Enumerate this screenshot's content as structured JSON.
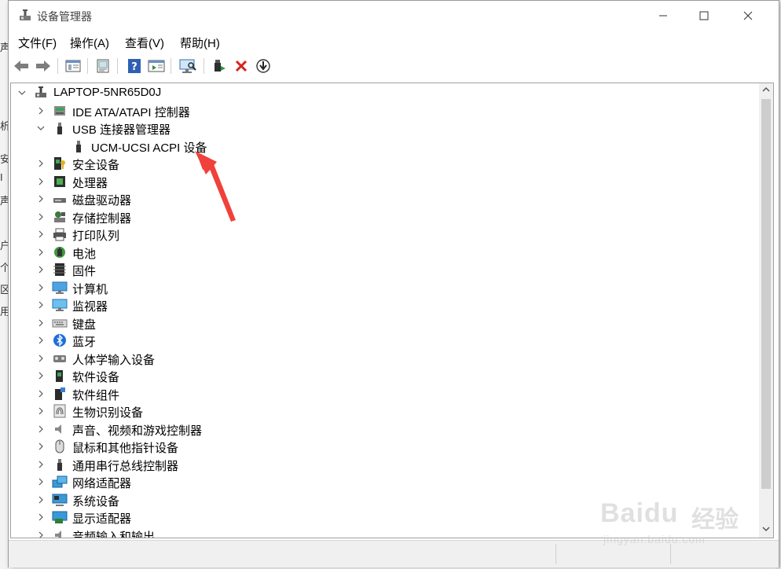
{
  "window": {
    "title": "设备管理器",
    "icon": "device-manager-icon"
  },
  "caption_buttons": [
    "minimize",
    "maximize",
    "close"
  ],
  "menu": [
    {
      "label": "文件(F)"
    },
    {
      "label": "操作(A)"
    },
    {
      "label": "查看(V)"
    },
    {
      "label": "帮助(H)"
    }
  ],
  "toolbar": [
    "back-icon",
    "forward-icon",
    "console-tree-icon",
    "properties-icon",
    "help-icon",
    "action-pane-icon",
    "scan-hardware-icon",
    "update-driver-icon",
    "uninstall-icon",
    "disable-device-icon"
  ],
  "tree": {
    "root": "LAPTOP-5NR65D0J",
    "items": [
      {
        "label": "IDE ATA/ATAPI 控制器",
        "icon": "ide-controller-icon",
        "expanded": false
      },
      {
        "label": "USB 连接器管理器",
        "icon": "usb-icon",
        "expanded": true,
        "children": [
          {
            "label": "UCM-UCSI ACPI 设备",
            "icon": "usb-device-icon"
          }
        ]
      },
      {
        "label": "安全设备",
        "icon": "security-device-icon",
        "expanded": false
      },
      {
        "label": "处理器",
        "icon": "processor-icon",
        "expanded": false
      },
      {
        "label": "磁盘驱动器",
        "icon": "disk-drive-icon",
        "expanded": false
      },
      {
        "label": "存储控制器",
        "icon": "storage-controller-icon",
        "expanded": false
      },
      {
        "label": "打印队列",
        "icon": "printer-icon",
        "expanded": false
      },
      {
        "label": "电池",
        "icon": "battery-icon",
        "expanded": false
      },
      {
        "label": "固件",
        "icon": "firmware-icon",
        "expanded": false
      },
      {
        "label": "计算机",
        "icon": "computer-icon",
        "expanded": false
      },
      {
        "label": "监视器",
        "icon": "monitor-icon",
        "expanded": false
      },
      {
        "label": "键盘",
        "icon": "keyboard-icon",
        "expanded": false
      },
      {
        "label": "蓝牙",
        "icon": "bluetooth-icon",
        "expanded": false
      },
      {
        "label": "人体学输入设备",
        "icon": "hid-icon",
        "expanded": false
      },
      {
        "label": "软件设备",
        "icon": "software-device-icon",
        "expanded": false
      },
      {
        "label": "软件组件",
        "icon": "software-component-icon",
        "expanded": false
      },
      {
        "label": "生物识别设备",
        "icon": "fingerprint-icon",
        "expanded": false
      },
      {
        "label": "声音、视频和游戏控制器",
        "icon": "speaker-icon",
        "expanded": false
      },
      {
        "label": "鼠标和其他指针设备",
        "icon": "mouse-icon",
        "expanded": false
      },
      {
        "label": "通用串行总线控制器",
        "icon": "usb-controller-icon",
        "expanded": false
      },
      {
        "label": "网络适配器",
        "icon": "network-adapter-icon",
        "expanded": false
      },
      {
        "label": "系统设备",
        "icon": "system-device-icon",
        "expanded": false
      },
      {
        "label": "显示适配器",
        "icon": "display-adapter-icon",
        "expanded": false
      },
      {
        "label": "音频输入和输出",
        "icon": "audio-io-icon",
        "expanded": false
      }
    ]
  },
  "background_chars": [
    "声",
    "析",
    "安",
    "I",
    "声",
    "户",
    "个",
    "区",
    "用"
  ],
  "annotation": {
    "type": "red-arrow",
    "target": "UCM-UCSI ACPI 设备",
    "color": "#f0413a"
  },
  "watermark": {
    "brand": "Baidu",
    "product": "经验",
    "url": "jingyan.baidu.com"
  },
  "colors": {
    "arrow": "#f0413a",
    "scrollbar_thumb": "#cdcdcd",
    "border": "#a0a0a0"
  }
}
